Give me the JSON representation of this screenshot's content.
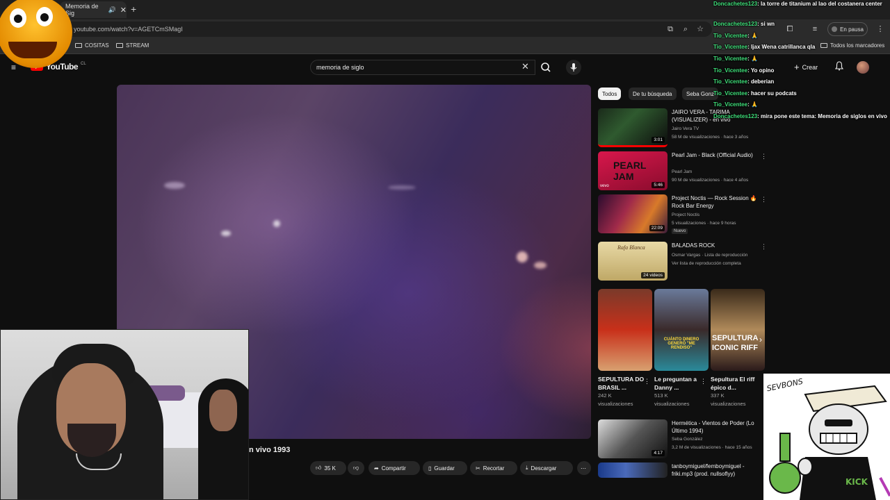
{
  "browser": {
    "tab_title": "Memoria de Sig",
    "url": "youtube.com/watch?v=AGETCmSMagI",
    "bookmarks": [
      "COSITAS",
      "STREAM"
    ],
    "pause_label": "En pausa",
    "all_bookmarks": "Todos los marcadores"
  },
  "youtube": {
    "logo": "YouTube",
    "country": "CL",
    "search_value": "memoria de siglo",
    "create_label": "Crear"
  },
  "video": {
    "title": "n vivo 1993"
  },
  "actions": {
    "likes": "35 K",
    "share": "Compartir",
    "save": "Guardar",
    "clip": "Recortar",
    "download": "Descargar"
  },
  "chips": [
    "Todos",
    "De tu búsqueda",
    "Seba Gonz"
  ],
  "recs": [
    {
      "title": "JAIRO VERA - TARIMA (VISUALIZER) - en vivo",
      "channel": "Jairo Vera TV",
      "meta": "58 M de visualizaciones · hace 3 años",
      "duration": "3:01"
    },
    {
      "title": "Pearl Jam - Black (Official Audio)",
      "channel": "Pearl Jam",
      "meta": "90 M de visualizaciones · hace 4 años",
      "duration": "5:46"
    },
    {
      "title": "Project Noctis — Rock Session 🔥 Rock Bar Energy",
      "channel": "Project Noctis",
      "meta": "5 visualizaciones · hace 9 horas",
      "duration": "22:09",
      "badge": "Nuevo"
    },
    {
      "title": "BALADAS ROCK",
      "channel": "Osmar Vargas · Lista de reproducción",
      "meta": "Ver lista de reproducción completa",
      "duration": "24 videos"
    }
  ],
  "shorts": [
    {
      "title": "SEPULTURA DO BRASIL ...",
      "views": "242 K",
      "unit": "visualizaciones"
    },
    {
      "title": "Le preguntan a Danny ...",
      "views": "513 K",
      "unit": "visualizaciones"
    },
    {
      "title": "Sepultura El riff épico d...",
      "views": "337 K",
      "unit": "visualizaciones"
    }
  ],
  "shorts_overlay": {
    "s2": "CUÁNTO DINERO GENERÓ \"ME RENDISO\"",
    "s3": "SEPULTURA ICONIC RIFF"
  },
  "recs2": [
    {
      "title": "Hermética - Vientos de Poder (Lo Último 1994)",
      "channel": "Seba González",
      "meta": "3,2 M de visualizaciones · hace 15 años",
      "duration": "4:17"
    },
    {
      "title": "tanboymiguel/femboymiguel - friki.mp3 (prod. nullsoflyy)"
    }
  ],
  "pearl_thumb_text": "PEARL JAM",
  "vevo": "vevo",
  "baladas_thumb": "Rafa Blanca",
  "chat": [
    {
      "user": "Doncachetes123",
      "msg": "la torre de titanium al lao del costanera center"
    },
    {
      "user": "Doncachetes123",
      "msg": "si wn"
    },
    {
      "user": "Tio_Vicentee",
      "msg": "🙏"
    },
    {
      "user": "Tio_Vicentee",
      "msg": "ljax Wena catrillanca qla"
    },
    {
      "user": "Tio_Vicentee",
      "msg": "🙏"
    },
    {
      "user": "Tio_Vicentee",
      "msg": "Yo opino"
    },
    {
      "user": "Tio_Vicentee",
      "msg": "deberian"
    },
    {
      "user": "Tio_Vicentee",
      "msg": "hacer su podcats"
    },
    {
      "user": "Tio_Vicentee",
      "msg": "🙏"
    },
    {
      "user": "Doncachetes123",
      "msg": "mira pone este tema: Memoria de siglos en vivo"
    }
  ],
  "sticker_text": "SEVBONS",
  "sticker_kick": "KICK"
}
